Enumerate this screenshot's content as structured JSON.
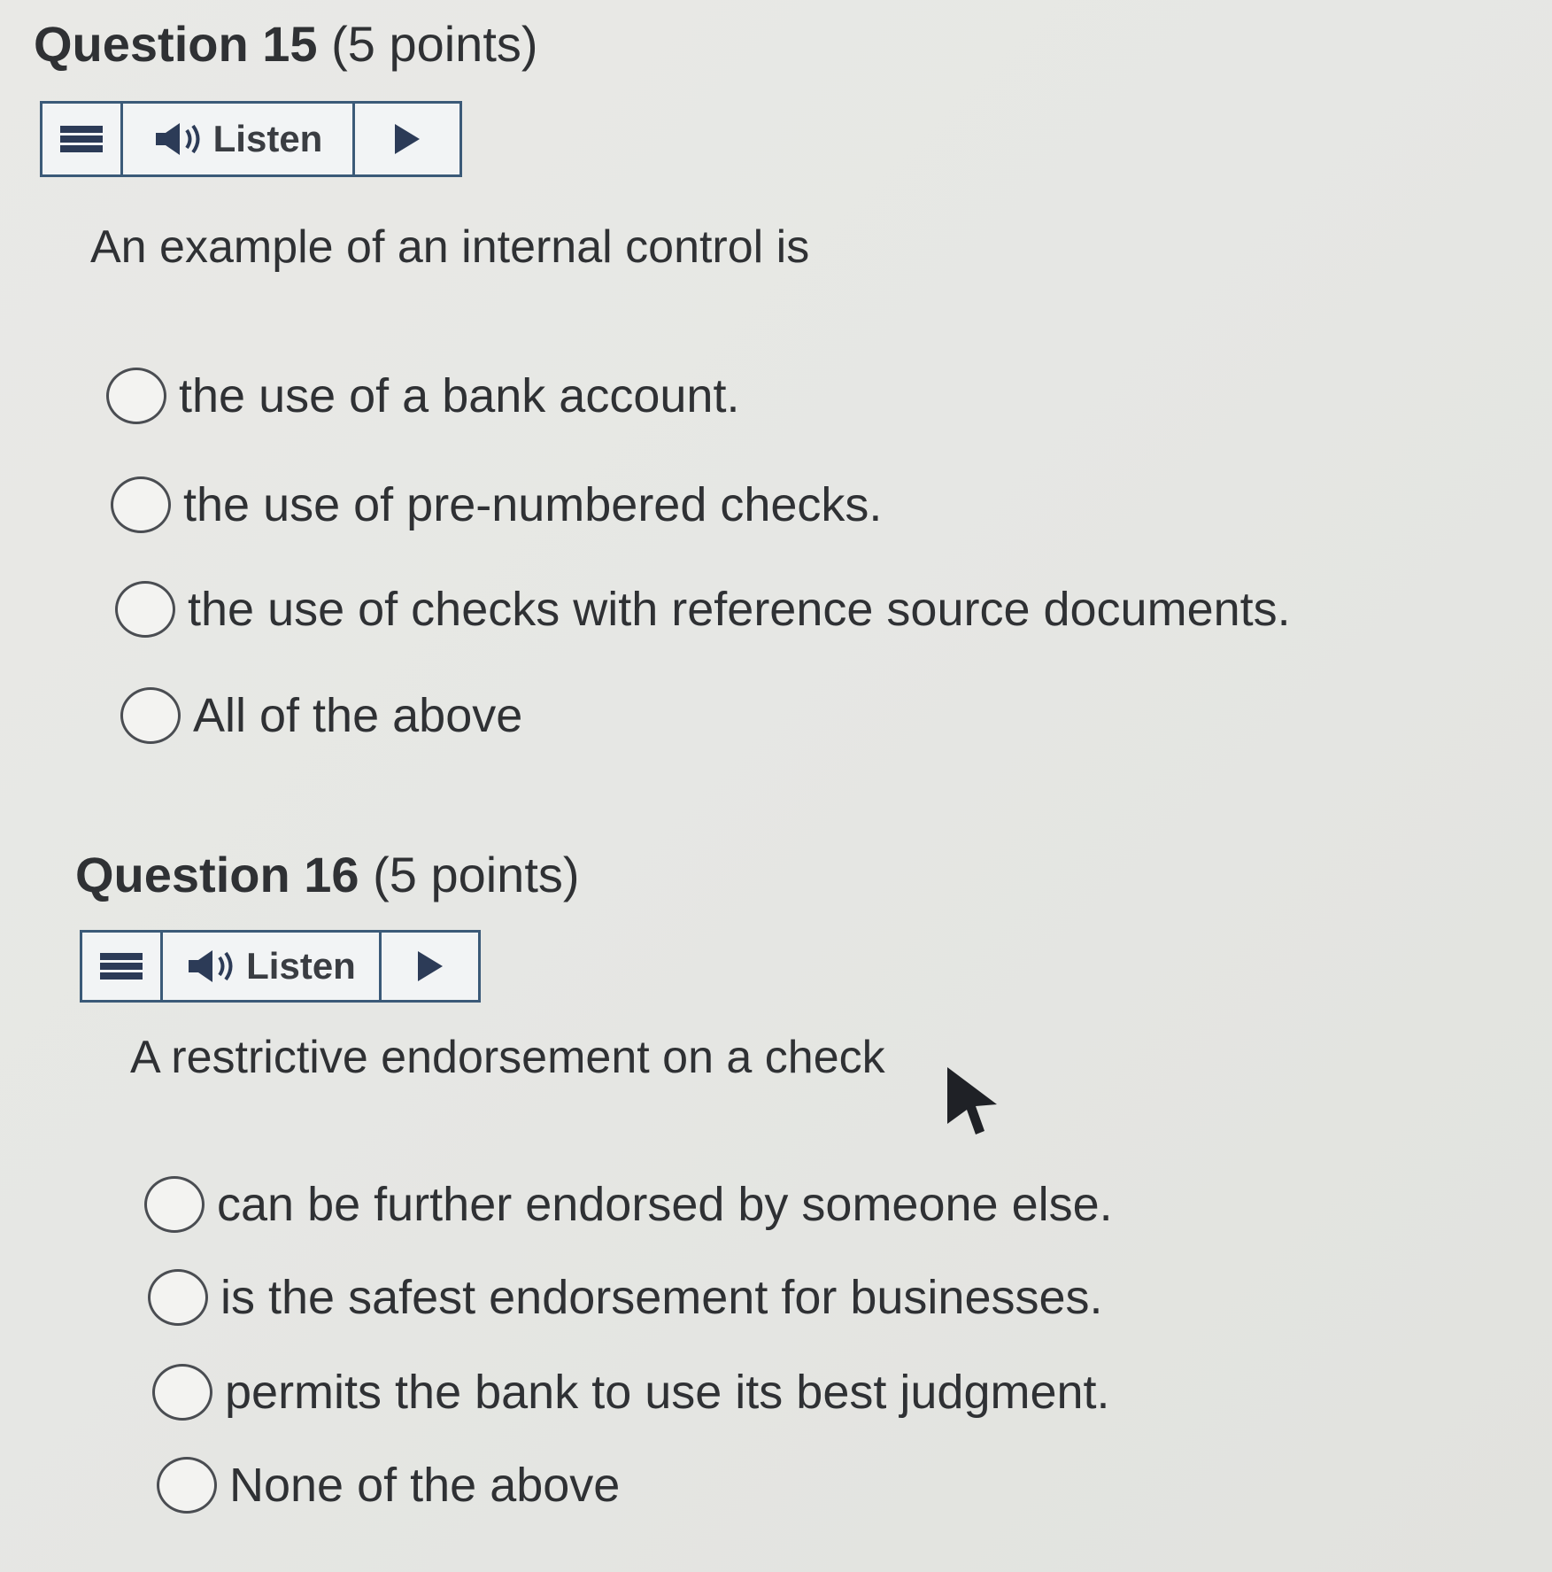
{
  "questions": [
    {
      "title_number": "Question 15",
      "title_points": "(5 points)",
      "listen": {
        "label": "Listen"
      },
      "prompt": "An example of an internal control is",
      "options": [
        "the use of a bank account.",
        "the use of pre-numbered checks.",
        "the use of checks with reference source documents.",
        "All of the above"
      ]
    },
    {
      "title_number": "Question 16",
      "title_points": "(5 points)",
      "listen": {
        "label": "Listen"
      },
      "prompt": "A restrictive endorsement on a check",
      "options": [
        "can be further endorsed by someone else.",
        "is the safest endorsement for businesses.",
        "permits the bank to use its best judgment.",
        "None of the above"
      ]
    }
  ],
  "icons": {
    "menu": "menu-icon",
    "speaker": "speaker-icon",
    "play": "play-icon",
    "cursor": "mouse-cursor-icon"
  },
  "colors": {
    "background": "#e6e7e4",
    "text": "#2f3134",
    "listen_border": "#3b5a78",
    "listen_bg": "#f2f4f5",
    "radio_border": "#4a4d52"
  }
}
